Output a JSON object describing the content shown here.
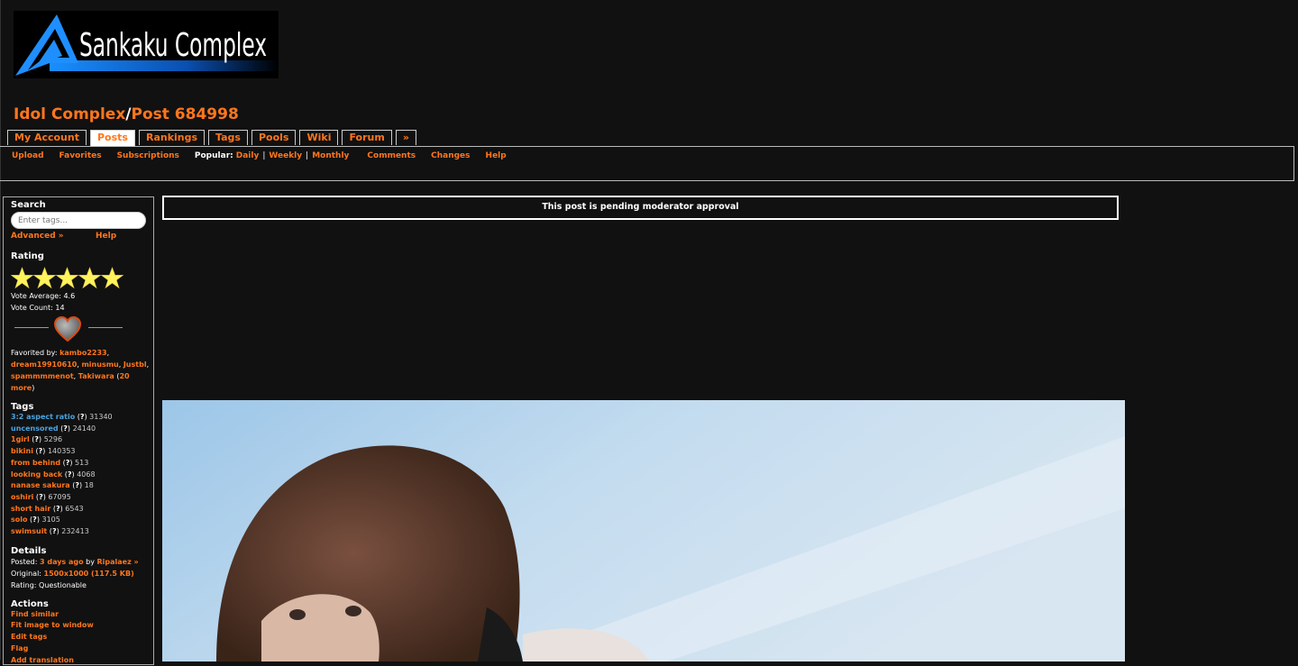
{
  "logo": {
    "text": "Sankaku Complex"
  },
  "title": {
    "site": "Idol Complex",
    "separator": "/",
    "post": "Post 684998"
  },
  "tabs": [
    {
      "label": "My Account",
      "active": false
    },
    {
      "label": "Posts",
      "active": true
    },
    {
      "label": "Rankings",
      "active": false
    },
    {
      "label": "Tags",
      "active": false
    },
    {
      "label": "Pools",
      "active": false
    },
    {
      "label": "Wiki",
      "active": false
    },
    {
      "label": "Forum",
      "active": false
    },
    {
      "label": "»",
      "active": false
    }
  ],
  "subnav": {
    "upload": "Upload",
    "favorites": "Favorites",
    "subscriptions": "Subscriptions",
    "popular_label": "Popular:",
    "daily": "Daily",
    "bar": "|",
    "weekly": "Weekly",
    "monthly": "Monthly",
    "comments": "Comments",
    "changes": "Changes",
    "help": "Help"
  },
  "sidebar": {
    "search": {
      "heading": "Search",
      "placeholder": "Enter tags...",
      "advanced": "Advanced »",
      "help": "Help"
    },
    "rating": {
      "heading": "Rating",
      "stars_filled": 5,
      "stars_total": 5,
      "vote_average_label": "Vote Average:",
      "vote_average": "4.6",
      "vote_count_label": "Vote Count:",
      "vote_count": "14"
    },
    "favorited": {
      "label": "Favorited by:",
      "users": [
        "kambo2233",
        "dream19910610",
        "minusmu",
        "Justbl",
        "spammmmenot",
        "Takiwara"
      ],
      "more": "20 more"
    },
    "tags": {
      "heading": "Tags",
      "question": "?",
      "items": [
        {
          "name": "3:2 aspect ratio",
          "count": "31340",
          "color": "blue"
        },
        {
          "name": "uncensored",
          "count": "24140",
          "color": "blue"
        },
        {
          "name": "1girl",
          "count": "5296",
          "color": "orange"
        },
        {
          "name": "bikini",
          "count": "140353",
          "color": "orange"
        },
        {
          "name": "from behind",
          "count": "513",
          "color": "orange"
        },
        {
          "name": "looking back",
          "count": "4068",
          "color": "orange"
        },
        {
          "name": "nanase sakura",
          "count": "18",
          "color": "orange"
        },
        {
          "name": "oshiri",
          "count": "67095",
          "color": "orange"
        },
        {
          "name": "short hair",
          "count": "6543",
          "color": "orange"
        },
        {
          "name": "solo",
          "count": "3105",
          "color": "orange"
        },
        {
          "name": "swimsuit",
          "count": "232413",
          "color": "orange"
        }
      ]
    },
    "details": {
      "heading": "Details",
      "posted_label": "Posted:",
      "posted_time": "3 days ago",
      "by_label": "by",
      "uploader": "Ripalaez »",
      "original_label": "Original:",
      "original": "1500x1000 (117.5 KB)",
      "rating_label": "Rating:",
      "rating": "Questionable"
    },
    "actions": {
      "heading": "Actions",
      "items": [
        "Find similar",
        "Fit image to window",
        "Edit tags",
        "Flag",
        "Add translation"
      ]
    }
  },
  "notice": "This post is pending moderator approval",
  "colors": {
    "accent": "#ff761c",
    "background": "#111111",
    "tag_blue": "#4aa3e0"
  }
}
